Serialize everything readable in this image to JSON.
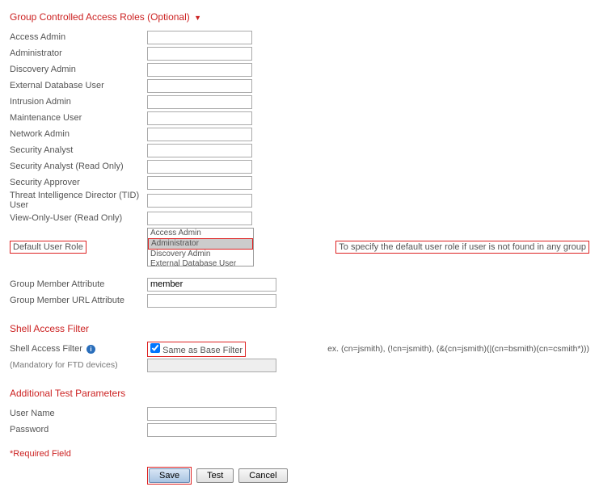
{
  "sections": {
    "group_roles_header": "Group Controlled Access Roles (Optional)",
    "shell_filter_header": "Shell Access Filter",
    "additional_params_header": "Additional Test Parameters"
  },
  "roles": {
    "access_admin": "Access Admin",
    "administrator": "Administrator",
    "discovery_admin": "Discovery Admin",
    "external_db_user": "External Database User",
    "intrusion_admin": "Intrusion Admin",
    "maintenance_user": "Maintenance User",
    "network_admin": "Network Admin",
    "security_analyst": "Security Analyst",
    "security_analyst_ro": "Security Analyst (Read Only)",
    "security_approver": "Security Approver",
    "tid_user": "Threat Intelligence Director (TID) User",
    "view_only_user_ro": "View-Only-User (Read Only)"
  },
  "default_role": {
    "label": "Default User Role",
    "hint": "To specify the default user role if user is not found in any group",
    "options": {
      "access_admin": "Access Admin",
      "administrator": "Administrator",
      "discovery_admin": "Discovery Admin",
      "external_db_user": "External Database User"
    }
  },
  "group_member": {
    "attr_label": "Group Member Attribute",
    "attr_value": "member",
    "url_attr_label": "Group Member URL Attribute"
  },
  "shell": {
    "filter_label": "Shell Access Filter",
    "same_base_label": "Same as Base Filter",
    "mandatory_note": "(Mandatory for FTD devices)",
    "example": "ex. (cn=jsmith), (!cn=jsmith), (&(cn=jsmith)(|(cn=bsmith)(cn=csmith*)))"
  },
  "test_params": {
    "username_label": "User Name",
    "password_label": "Password"
  },
  "required_label": "*Required Field",
  "buttons": {
    "save": "Save",
    "test": "Test",
    "cancel": "Cancel"
  }
}
